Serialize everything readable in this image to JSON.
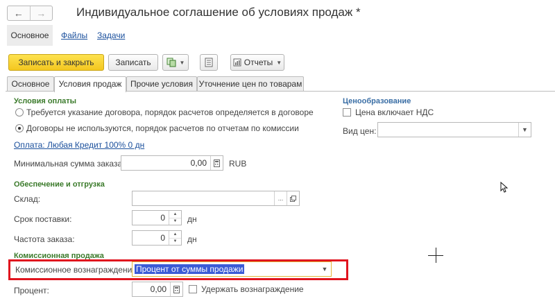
{
  "window": {
    "title": "Индивидуальное соглашение об условиях продаж *"
  },
  "icons": {
    "back": "arrow-left-icon",
    "forward": "arrow-right-icon"
  },
  "sections": [
    {
      "label": "Основное"
    },
    {
      "label": "Файлы"
    },
    {
      "label": "Задачи"
    }
  ],
  "toolbar": {
    "save_close": "Записать и закрыть",
    "save": "Записать",
    "reports": "Отчеты"
  },
  "tabs": [
    {
      "label": "Основное"
    },
    {
      "label": "Условия продаж"
    },
    {
      "label": "Прочие условия"
    },
    {
      "label": "Уточнение цен по товарам"
    }
  ],
  "payment": {
    "title": "Условия оплаты",
    "option1": "Требуется указание договора, порядок расчетов определяется в договоре",
    "option2": "Договоры не используются, порядок расчетов по отчетам по комиссии",
    "link": "Оплата: Любая Кредит 100% 0 дн",
    "min_label": "Минимальная сумма заказа:",
    "min_value": "0,00",
    "currency": "RUB"
  },
  "pricing": {
    "title": "Ценообразование",
    "vat_label": "Цена включает НДС",
    "price_type_label": "Вид цен:",
    "price_type_value": ""
  },
  "shipping": {
    "title": "Обеспечение и отгрузка",
    "warehouse_label": "Склад:",
    "warehouse_value": "",
    "delivery_label": "Срок поставки:",
    "delivery_value": "0",
    "frequency_label": "Частота заказа:",
    "frequency_value": "0",
    "days_unit": "дн"
  },
  "commission": {
    "title": "Комиссионная продажа",
    "reward_label": "Комиссионное вознаграждение:",
    "reward_value": "Процент от суммы продажи",
    "percent_label": "Процент:",
    "percent_value": "0,00",
    "withhold_label": "Удержать вознаграждение"
  },
  "colors": {
    "accent_yellow": "#f4c720",
    "group_green": "#3a7a2a",
    "group_blue": "#3a6ea5",
    "highlight_red": "#e0141e",
    "selection": "#3b5bd6"
  }
}
